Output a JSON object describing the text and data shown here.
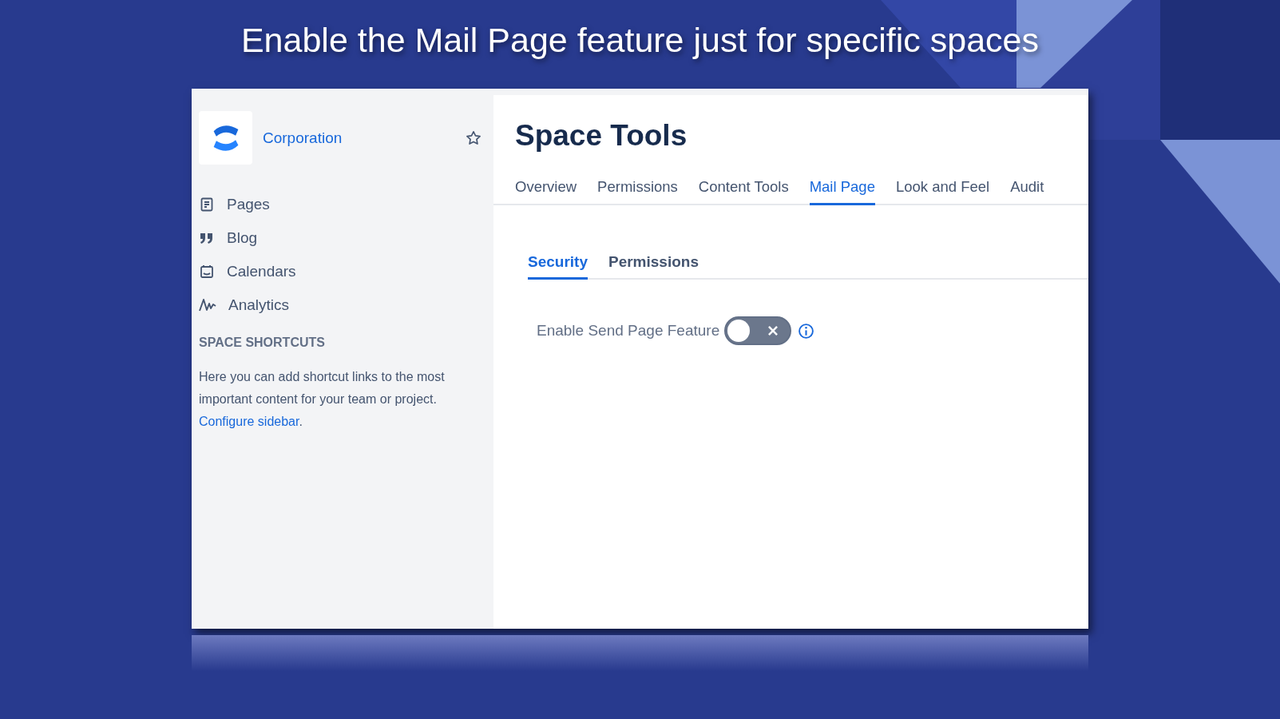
{
  "headline": "Enable the Mail Page feature just for specific spaces",
  "sidebar": {
    "space_name": "Corporation",
    "starred": false,
    "items": [
      {
        "label": "Pages",
        "kind": "pages"
      },
      {
        "label": "Blog",
        "kind": "blog"
      },
      {
        "label": "Calendars",
        "kind": "calendars"
      },
      {
        "label": "Analytics",
        "kind": "analytics"
      }
    ],
    "section_title": "SPACE SHORTCUTS",
    "help_text": "Here you can add shortcut links to the most important content for your team or project.",
    "help_link": "Configure sidebar",
    "help_end": "."
  },
  "page_title": "Space Tools",
  "tabs": [
    {
      "label": "Overview",
      "selected": false
    },
    {
      "label": "Permissions",
      "selected": false
    },
    {
      "label": "Content Tools",
      "selected": false
    },
    {
      "label": "Mail Page",
      "selected": true
    },
    {
      "label": "Look and Feel",
      "selected": false
    },
    {
      "label": "Audit",
      "selected": false
    }
  ],
  "subtabs": [
    {
      "label": "Security",
      "selected": true
    },
    {
      "label": "Permissions",
      "selected": false
    }
  ],
  "setting": {
    "label": "Enable Send Page Feature",
    "on": false
  }
}
